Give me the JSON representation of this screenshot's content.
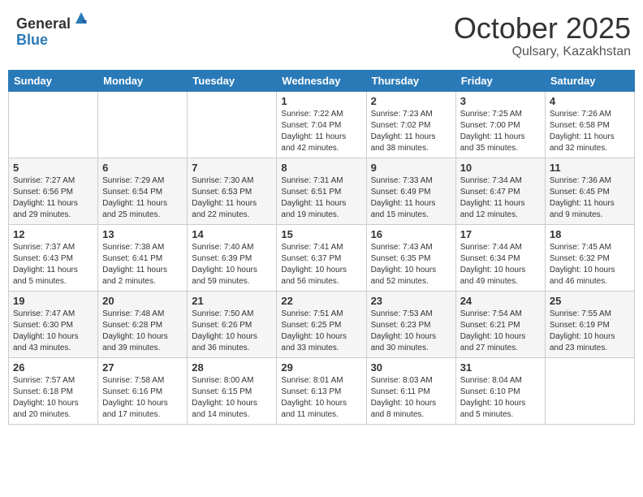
{
  "header": {
    "logo_general": "General",
    "logo_blue": "Blue",
    "month": "October 2025",
    "location": "Qulsary, Kazakhstan"
  },
  "weekdays": [
    "Sunday",
    "Monday",
    "Tuesday",
    "Wednesday",
    "Thursday",
    "Friday",
    "Saturday"
  ],
  "weeks": [
    [
      {
        "day": "",
        "sunrise": "",
        "sunset": "",
        "daylight": ""
      },
      {
        "day": "",
        "sunrise": "",
        "sunset": "",
        "daylight": ""
      },
      {
        "day": "",
        "sunrise": "",
        "sunset": "",
        "daylight": ""
      },
      {
        "day": "1",
        "sunrise": "Sunrise: 7:22 AM",
        "sunset": "Sunset: 7:04 PM",
        "daylight": "Daylight: 11 hours and 42 minutes."
      },
      {
        "day": "2",
        "sunrise": "Sunrise: 7:23 AM",
        "sunset": "Sunset: 7:02 PM",
        "daylight": "Daylight: 11 hours and 38 minutes."
      },
      {
        "day": "3",
        "sunrise": "Sunrise: 7:25 AM",
        "sunset": "Sunset: 7:00 PM",
        "daylight": "Daylight: 11 hours and 35 minutes."
      },
      {
        "day": "4",
        "sunrise": "Sunrise: 7:26 AM",
        "sunset": "Sunset: 6:58 PM",
        "daylight": "Daylight: 11 hours and 32 minutes."
      }
    ],
    [
      {
        "day": "5",
        "sunrise": "Sunrise: 7:27 AM",
        "sunset": "Sunset: 6:56 PM",
        "daylight": "Daylight: 11 hours and 29 minutes."
      },
      {
        "day": "6",
        "sunrise": "Sunrise: 7:29 AM",
        "sunset": "Sunset: 6:54 PM",
        "daylight": "Daylight: 11 hours and 25 minutes."
      },
      {
        "day": "7",
        "sunrise": "Sunrise: 7:30 AM",
        "sunset": "Sunset: 6:53 PM",
        "daylight": "Daylight: 11 hours and 22 minutes."
      },
      {
        "day": "8",
        "sunrise": "Sunrise: 7:31 AM",
        "sunset": "Sunset: 6:51 PM",
        "daylight": "Daylight: 11 hours and 19 minutes."
      },
      {
        "day": "9",
        "sunrise": "Sunrise: 7:33 AM",
        "sunset": "Sunset: 6:49 PM",
        "daylight": "Daylight: 11 hours and 15 minutes."
      },
      {
        "day": "10",
        "sunrise": "Sunrise: 7:34 AM",
        "sunset": "Sunset: 6:47 PM",
        "daylight": "Daylight: 11 hours and 12 minutes."
      },
      {
        "day": "11",
        "sunrise": "Sunrise: 7:36 AM",
        "sunset": "Sunset: 6:45 PM",
        "daylight": "Daylight: 11 hours and 9 minutes."
      }
    ],
    [
      {
        "day": "12",
        "sunrise": "Sunrise: 7:37 AM",
        "sunset": "Sunset: 6:43 PM",
        "daylight": "Daylight: 11 hours and 5 minutes."
      },
      {
        "day": "13",
        "sunrise": "Sunrise: 7:38 AM",
        "sunset": "Sunset: 6:41 PM",
        "daylight": "Daylight: 11 hours and 2 minutes."
      },
      {
        "day": "14",
        "sunrise": "Sunrise: 7:40 AM",
        "sunset": "Sunset: 6:39 PM",
        "daylight": "Daylight: 10 hours and 59 minutes."
      },
      {
        "day": "15",
        "sunrise": "Sunrise: 7:41 AM",
        "sunset": "Sunset: 6:37 PM",
        "daylight": "Daylight: 10 hours and 56 minutes."
      },
      {
        "day": "16",
        "sunrise": "Sunrise: 7:43 AM",
        "sunset": "Sunset: 6:35 PM",
        "daylight": "Daylight: 10 hours and 52 minutes."
      },
      {
        "day": "17",
        "sunrise": "Sunrise: 7:44 AM",
        "sunset": "Sunset: 6:34 PM",
        "daylight": "Daylight: 10 hours and 49 minutes."
      },
      {
        "day": "18",
        "sunrise": "Sunrise: 7:45 AM",
        "sunset": "Sunset: 6:32 PM",
        "daylight": "Daylight: 10 hours and 46 minutes."
      }
    ],
    [
      {
        "day": "19",
        "sunrise": "Sunrise: 7:47 AM",
        "sunset": "Sunset: 6:30 PM",
        "daylight": "Daylight: 10 hours and 43 minutes."
      },
      {
        "day": "20",
        "sunrise": "Sunrise: 7:48 AM",
        "sunset": "Sunset: 6:28 PM",
        "daylight": "Daylight: 10 hours and 39 minutes."
      },
      {
        "day": "21",
        "sunrise": "Sunrise: 7:50 AM",
        "sunset": "Sunset: 6:26 PM",
        "daylight": "Daylight: 10 hours and 36 minutes."
      },
      {
        "day": "22",
        "sunrise": "Sunrise: 7:51 AM",
        "sunset": "Sunset: 6:25 PM",
        "daylight": "Daylight: 10 hours and 33 minutes."
      },
      {
        "day": "23",
        "sunrise": "Sunrise: 7:53 AM",
        "sunset": "Sunset: 6:23 PM",
        "daylight": "Daylight: 10 hours and 30 minutes."
      },
      {
        "day": "24",
        "sunrise": "Sunrise: 7:54 AM",
        "sunset": "Sunset: 6:21 PM",
        "daylight": "Daylight: 10 hours and 27 minutes."
      },
      {
        "day": "25",
        "sunrise": "Sunrise: 7:55 AM",
        "sunset": "Sunset: 6:19 PM",
        "daylight": "Daylight: 10 hours and 23 minutes."
      }
    ],
    [
      {
        "day": "26",
        "sunrise": "Sunrise: 7:57 AM",
        "sunset": "Sunset: 6:18 PM",
        "daylight": "Daylight: 10 hours and 20 minutes."
      },
      {
        "day": "27",
        "sunrise": "Sunrise: 7:58 AM",
        "sunset": "Sunset: 6:16 PM",
        "daylight": "Daylight: 10 hours and 17 minutes."
      },
      {
        "day": "28",
        "sunrise": "Sunrise: 8:00 AM",
        "sunset": "Sunset: 6:15 PM",
        "daylight": "Daylight: 10 hours and 14 minutes."
      },
      {
        "day": "29",
        "sunrise": "Sunrise: 8:01 AM",
        "sunset": "Sunset: 6:13 PM",
        "daylight": "Daylight: 10 hours and 11 minutes."
      },
      {
        "day": "30",
        "sunrise": "Sunrise: 8:03 AM",
        "sunset": "Sunset: 6:11 PM",
        "daylight": "Daylight: 10 hours and 8 minutes."
      },
      {
        "day": "31",
        "sunrise": "Sunrise: 8:04 AM",
        "sunset": "Sunset: 6:10 PM",
        "daylight": "Daylight: 10 hours and 5 minutes."
      },
      {
        "day": "",
        "sunrise": "",
        "sunset": "",
        "daylight": ""
      }
    ]
  ]
}
